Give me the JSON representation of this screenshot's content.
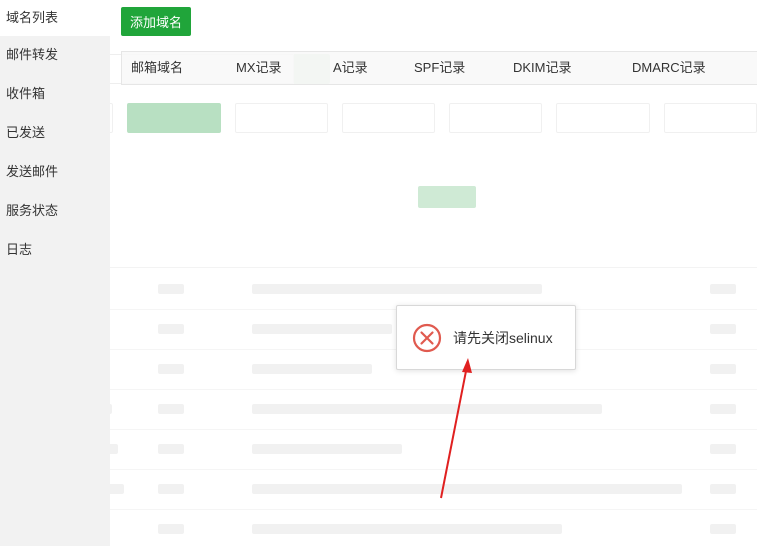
{
  "sidebar": {
    "items": [
      {
        "label": "域名列表",
        "active": true
      },
      {
        "label": "邮件转发"
      },
      {
        "label": "收件箱"
      },
      {
        "label": "已发送"
      },
      {
        "label": "发送邮件"
      },
      {
        "label": "服务状态"
      },
      {
        "label": "日志"
      }
    ]
  },
  "toolbar": {
    "add_domain_label": "添加域名"
  },
  "table": {
    "columns": [
      "邮箱域名",
      "MX记录",
      "A记录",
      "SPF记录",
      "DKIM记录",
      "DMARC记录"
    ]
  },
  "toast": {
    "message": "请先关闭selinux",
    "icon": "error-circle-icon",
    "icon_color": "#e05a4f"
  },
  "colors": {
    "accent": "#20a53a",
    "arrow": "#e02020"
  }
}
